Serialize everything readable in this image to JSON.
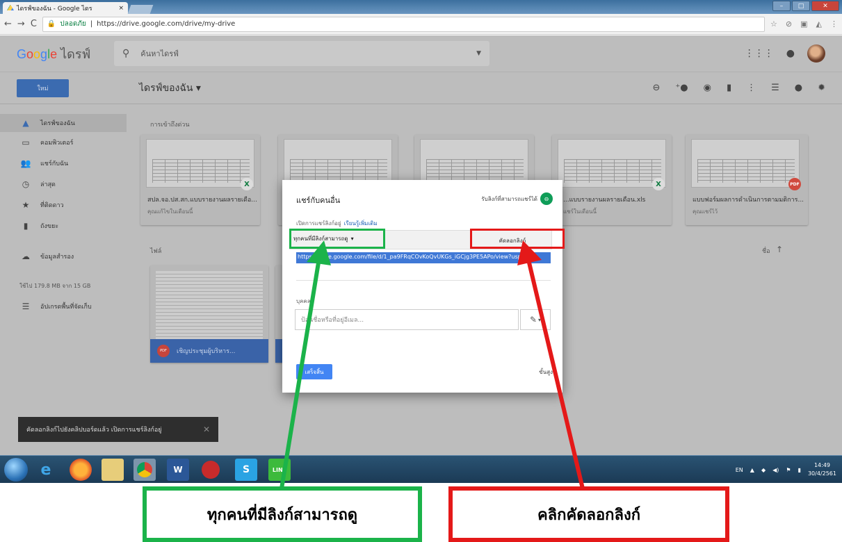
{
  "browser": {
    "tab_title": "ไดรฟ์ของฉัน - Google ไดร",
    "tab_close": "×",
    "secure_label": "ปลอดภัย",
    "url": "https://drive.google.com/drive/my-drive",
    "win_controls": [
      "–",
      "□",
      "✕"
    ]
  },
  "drive": {
    "logo_word": "ไดรฟ์",
    "search_placeholder": "ค้นหาไดรฟ์",
    "new_button": "ใหม่",
    "page_title": "ไดรฟ์ของฉัน ▾",
    "toolbar_icons": [
      "link-icon",
      "add-person-icon",
      "preview-icon",
      "trash-icon",
      "more-vert-icon",
      "list-view-icon",
      "info-icon",
      "settings-icon"
    ]
  },
  "sidebar": {
    "items": [
      {
        "label": "ไดรฟ์ของฉัน",
        "icon": "drive-icon"
      },
      {
        "label": "คอมพิวเตอร์",
        "icon": "computer-icon"
      },
      {
        "label": "แชร์กับฉัน",
        "icon": "people-icon"
      },
      {
        "label": "ล่าสุด",
        "icon": "clock-icon"
      },
      {
        "label": "ที่ติดดาว",
        "icon": "star-icon"
      },
      {
        "label": "ถังขยะ",
        "icon": "trash-icon"
      },
      {
        "label": "ข้อมูลสำรอง",
        "icon": "cloud-icon"
      }
    ],
    "storage": "ใช้ไป 179.8 MB จาก 15 GB",
    "upgrade": "อัปเกรดพื้นที่จัดเก็บ"
  },
  "main": {
    "quick_access_label": "การเข้าถึงด่วน",
    "files_label": "ไฟล์",
    "sort_label": "ชื่อ",
    "sort_arrow": "↑",
    "quick_cards": [
      {
        "name": "สปล.จอ.ปส.สก.แบบรายงานผลรายเดือ...",
        "sub": "คุณแก้ไขในเดือนนี้",
        "badge": "X"
      },
      {
        "name": "",
        "sub": "",
        "badge": ""
      },
      {
        "name": "",
        "sub": "",
        "badge": ""
      },
      {
        "name": "...แบบรายงานผลรายเดือน.xls",
        "sub": "แชร์ในเดือนนี้",
        "badge": "X"
      },
      {
        "name": "แบบฟอร์มผลการดำเนินการตามมติการ...",
        "sub": "คุณแชร์ไว้",
        "badge": "PDF"
      }
    ],
    "file_card": {
      "name": "เชิญประชุมผู้บริหาร...",
      "badge": "PDF"
    }
  },
  "toast": {
    "text": "คัดลอกลิงก์ไปยังคลิปบอร์ดแล้ว เปิดการแชร์ลิงก์อยู่",
    "close": "✕"
  },
  "dialog": {
    "title": "แชร์กับคนอื่น",
    "get_link": "รับลิงก์ที่สามารถแชร์ได้",
    "status": "เปิดการแชร์ลิงก์อยู่",
    "learn_more": "เรียนรู้เพิ่มเติม",
    "access_option": "ทุกคนที่มีลิงก์สามารถดู",
    "copy_link": "คัดลอกลิงก์",
    "share_url": "https://drive.google.com/file/d/1_pa9FRqCOvKoQvUKGs_iGCjg3PE5APo/view?usp",
    "people_label": "บุคคล",
    "people_placeholder": "ป้อนชื่อหรือที่อยู่อีเมล...",
    "done": "เสร็จสิ้น",
    "advanced": "ขั้นสูง"
  },
  "taskbar": {
    "apps": [
      "ie-icon",
      "firefox-icon",
      "explorer-icon",
      "chrome-icon",
      "word-icon",
      "app-icon",
      "skype-icon",
      "line-icon"
    ],
    "lang": "EN",
    "time": "14:49",
    "date": "30/4/2561"
  },
  "callouts": {
    "green": "ทุกคนที่มีลิงก์สามารถดู",
    "red": "คลิกคัดลอกลิงก์"
  },
  "colors": {
    "green": "#1bb34a",
    "red": "#e41919",
    "accent": "#4285f4"
  }
}
